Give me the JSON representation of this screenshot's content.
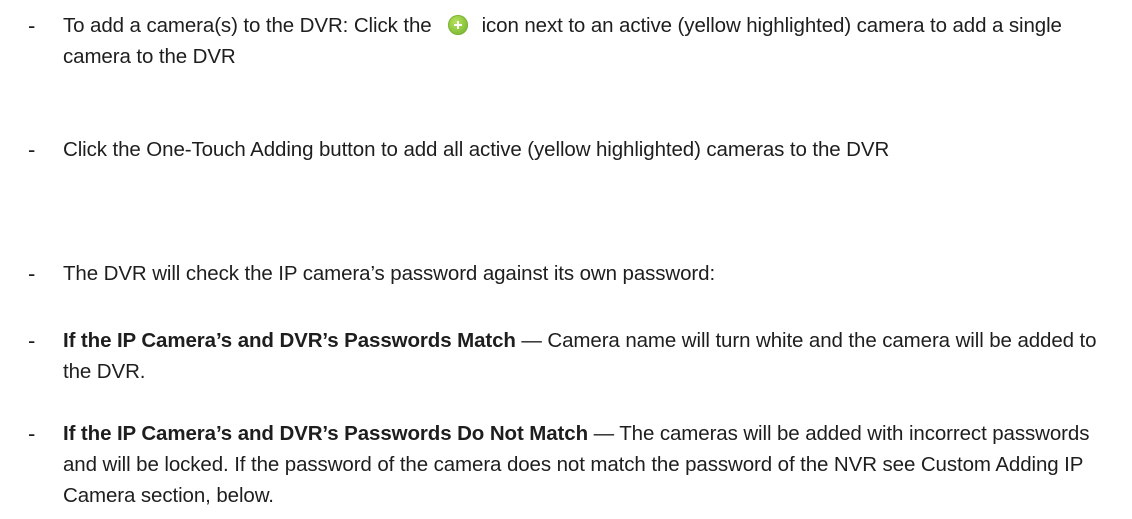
{
  "bullets": [
    {
      "marker": "-",
      "before_icon": "To add a camera(s) to the DVR: Click the",
      "icon": "add-circle-icon",
      "after_icon": "icon next to an active (yellow highlighted) camera to add a single camera to the DVR"
    },
    {
      "marker": "-",
      "text": "Click the One-Touch Adding button to add all active (yellow highlighted) cameras to the DVR"
    },
    {
      "marker": "-",
      "text": "The DVR will check the IP camera’s password against its own password:"
    },
    {
      "marker": "-",
      "bold": "If the IP Camera’s and DVR’s Passwords Match",
      "text": " — Camera name will turn white and the camera will be added to the DVR."
    },
    {
      "marker": "-",
      "bold": "If the IP Camera’s and DVR’s Passwords Do Not Match",
      "text": " — The cameras will be added with incorrect passwords and will be locked. If the password of the camera does not match the password of the NVR see Custom Adding IP Camera section, below."
    }
  ],
  "colors": {
    "text": "#1e1e1e",
    "icon_green": "#8cc63f"
  }
}
